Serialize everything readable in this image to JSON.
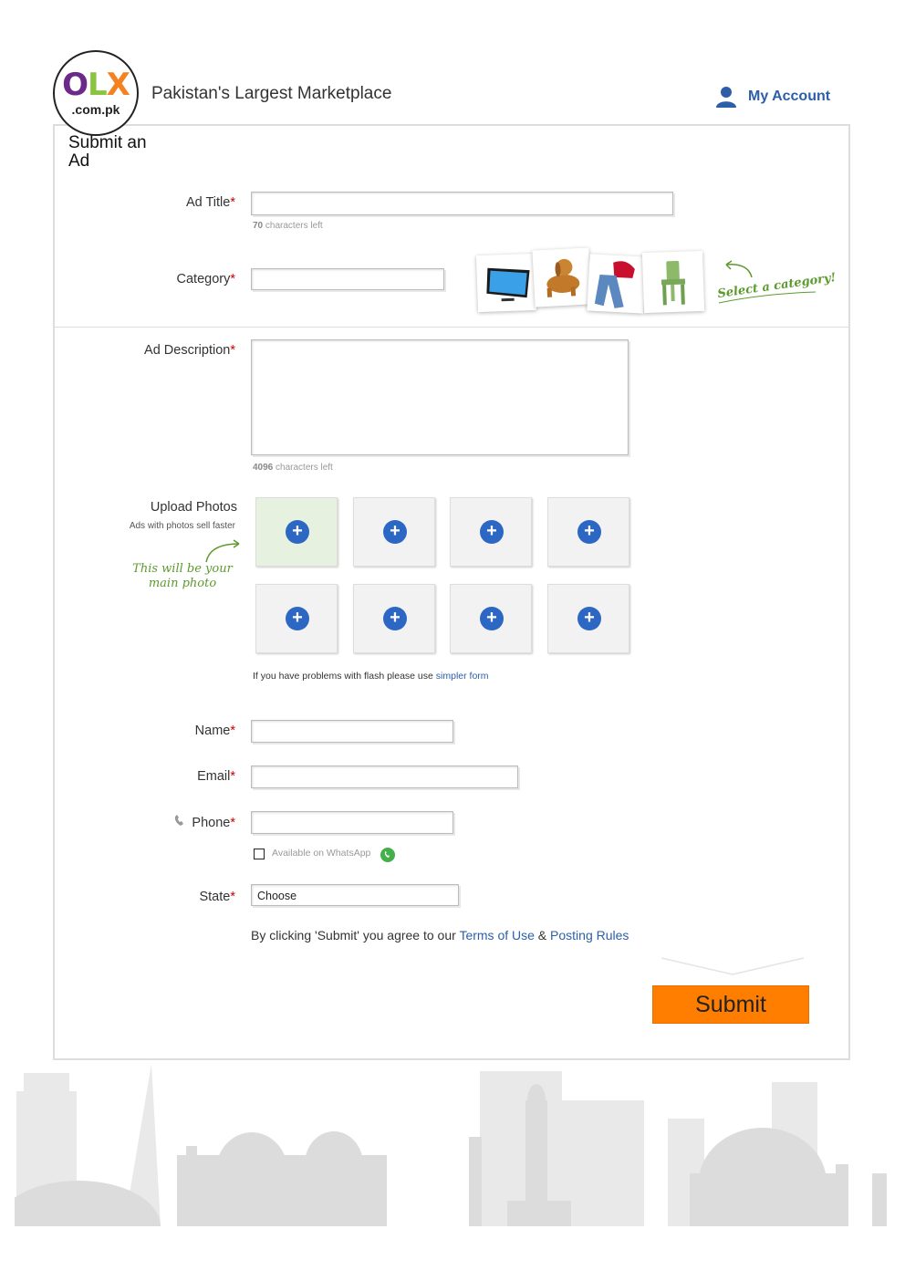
{
  "header": {
    "logo": {
      "letters": [
        "O",
        "L",
        "X"
      ],
      "domain": ".com.pk"
    },
    "tagline": "Pakistan's Largest Marketplace",
    "account_label": "My Account",
    "account_icon": "user-icon"
  },
  "form": {
    "title": "Submit an Ad",
    "required_mark": "*",
    "ad_title": {
      "label": "Ad Title",
      "value": "",
      "chars_left": "70",
      "chars_left_suffix": "characters left"
    },
    "category": {
      "label": "Category",
      "value": "",
      "callout": "Select a category!",
      "icons": [
        "tv-icon",
        "dog-icon",
        "clothes-icon",
        "chair-icon"
      ]
    },
    "description": {
      "label": "Ad Description",
      "value": "",
      "chars_left": "4096",
      "chars_left_suffix": "characters left"
    },
    "photos": {
      "label": "Upload Photos",
      "sublabel": "Ads with photos sell faster",
      "main_note_line1": "This will be your",
      "main_note_line2": "main photo",
      "slots": [
        "+",
        "+",
        "+",
        "+",
        "+",
        "+",
        "+",
        "+"
      ],
      "flash_note": "If you have problems with flash please use",
      "flash_link": "simpler form"
    },
    "name": {
      "label": "Name",
      "value": ""
    },
    "email": {
      "label": "Email",
      "value": ""
    },
    "phone": {
      "label": "Phone",
      "value": "",
      "icon": "phone-icon"
    },
    "whatsapp": {
      "label": "Available on WhatsApp",
      "checked": false,
      "icon": "whatsapp-icon"
    },
    "state": {
      "label": "State",
      "selected": "Choose"
    },
    "terms": {
      "prefix": "By clicking 'Submit' you agree to our",
      "terms_link": "Terms of Use",
      "amp": "&",
      "rules_link": "Posting Rules"
    },
    "submit_label": "Submit"
  },
  "colors": {
    "accent": "#ff7e00",
    "link": "#2c5fa8",
    "required": "#cc0000",
    "plus": "#2d67c4",
    "note_green": "#5c9a2e"
  }
}
